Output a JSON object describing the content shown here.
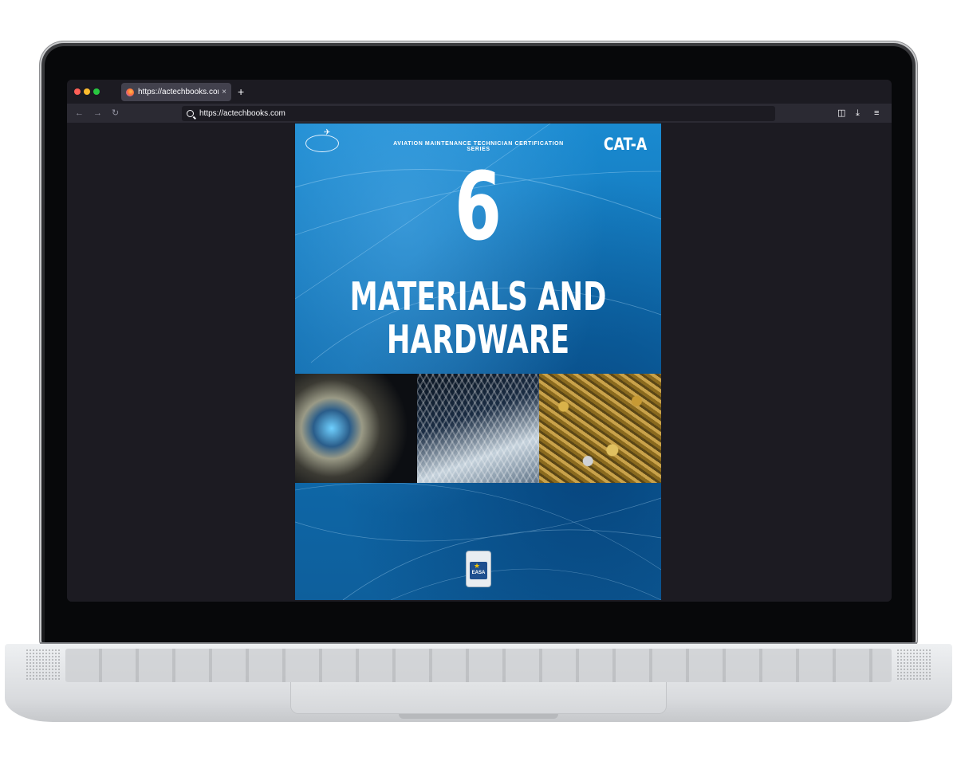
{
  "browser": {
    "tab": {
      "title": "https://actechbooks.com",
      "close_glyph": "×",
      "icon": "firefox-icon"
    },
    "new_tab_glyph": "+",
    "nav": {
      "back_glyph": "←",
      "forward_glyph": "→",
      "reload_glyph": "↻"
    },
    "url": "https://actechbooks.com",
    "toolbar": {
      "pocket_glyph": "◫",
      "download_glyph": "⤓",
      "menu_glyph": "≡"
    }
  },
  "cover": {
    "series": "AVIATION MAINTENANCE TECHNICIAN CERTIFICATION SERIES",
    "category": "CAT-A",
    "module_number": "6",
    "title_line1": "MATERIALS AND",
    "title_line2": "HARDWARE",
    "badge": {
      "text": "EASA",
      "star_glyph": "★"
    }
  },
  "colors": {
    "browser_bg": "#1c1b22",
    "toolbar_bg": "#2b2a33",
    "tab_bg": "#42414d",
    "cover_blue": "#1a8ad0"
  }
}
